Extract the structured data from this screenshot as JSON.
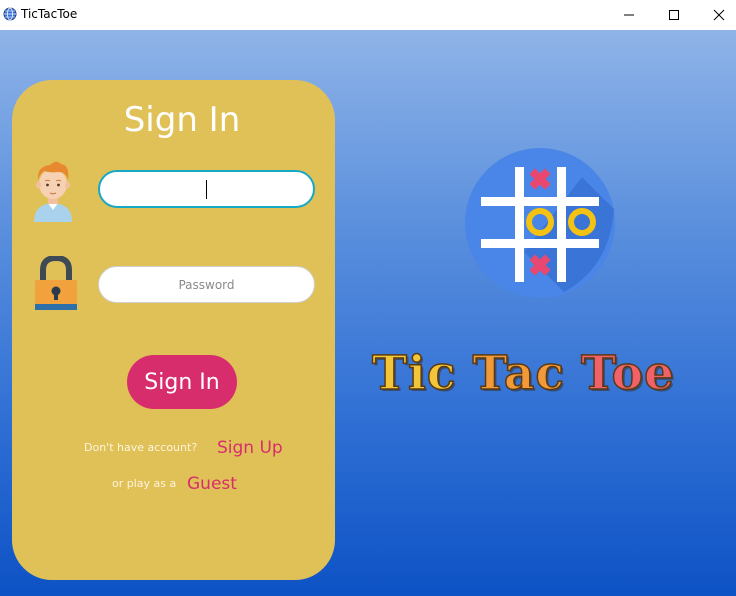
{
  "window": {
    "title": "TicTacToe",
    "icon": "globe-icon",
    "controls": [
      "minimize-icon",
      "maximize-icon",
      "close-icon"
    ]
  },
  "signin": {
    "heading": "Sign In",
    "username_value": "",
    "password_placeholder": "Password",
    "button_label": "Sign In",
    "no_account_text": "Don't have account?",
    "signup_link": "Sign Up",
    "guest_text": "or play as a",
    "guest_link": "Guest"
  },
  "branding": {
    "game_title_words": [
      "Tic",
      "Tac",
      "Toe"
    ],
    "logo_icon": "tic-tac-toe-logo-icon"
  },
  "colors": {
    "panel": "#e0c158",
    "accent": "#d82d6d",
    "background_top": "#8fb4e8",
    "background_bottom": "#0d52c5",
    "logo_circle": "#4a86e8"
  }
}
